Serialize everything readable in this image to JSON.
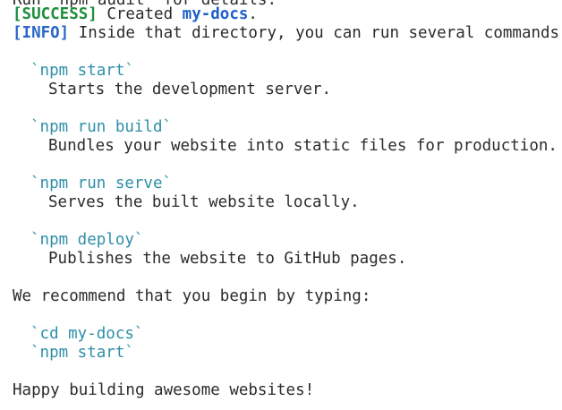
{
  "terminal": {
    "top_partial": "Run `npm audit` for details.",
    "success_tag": "[SUCCESS]",
    "success_text": " Created ",
    "project_name": "my-docs",
    "success_end": ".",
    "info_tag": "[INFO]",
    "info_text": " Inside that directory, you can run several commands:",
    "commands": [
      {
        "cmd": "`npm start`",
        "desc": "Starts the development server."
      },
      {
        "cmd": "`npm run build`",
        "desc": "Bundles your website into static files for production."
      },
      {
        "cmd": "`npm run serve`",
        "desc": "Serves the built website locally."
      },
      {
        "cmd": "`npm deploy`",
        "desc": "Publishes the website to GitHub pages."
      }
    ],
    "recommend": "We recommend that you begin by typing:",
    "begin_cmds": [
      "`cd my-docs`",
      "`npm start`"
    ],
    "farewell": "Happy building awesome websites!"
  },
  "colors": {
    "success": "#1d8f3a",
    "info": "#2a66c9",
    "command": "#2f8fa8",
    "text": "#2b2b2b"
  }
}
